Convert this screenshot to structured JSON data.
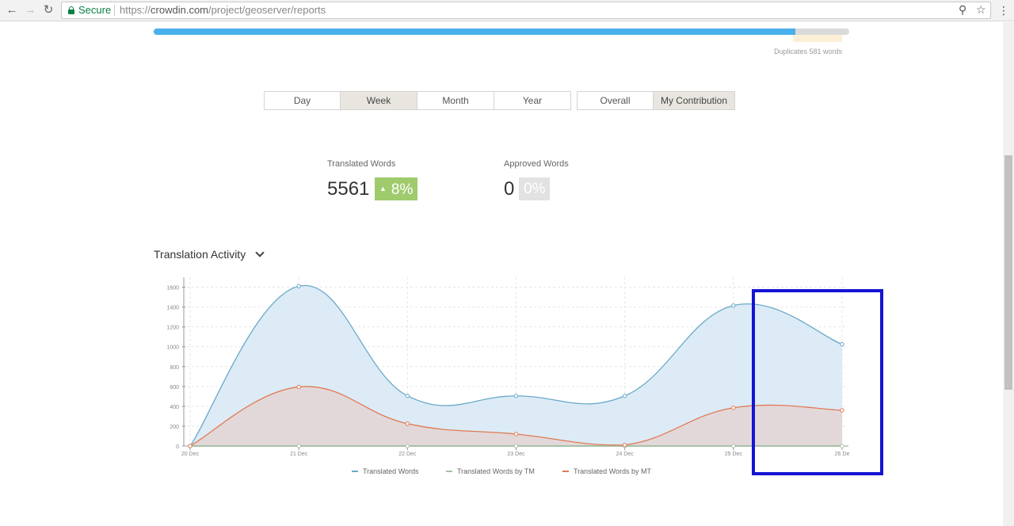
{
  "browser": {
    "back_icon": "back-arrow-icon",
    "forward_icon": "forward-arrow-icon",
    "reload_icon": "reload-icon",
    "secure_label": "Secure",
    "url_scheme": "https://",
    "url_host": "crowdin.com",
    "url_path": "/project/geoserver/reports"
  },
  "progress": {
    "translated_fraction": 0.922,
    "duplicates_text": "Duplicates 581 words",
    "colors": {
      "fill": "#48b0ea",
      "track": "#dadada",
      "duplicates": "#fbefd6"
    }
  },
  "period_tabs": [
    {
      "label": "Day",
      "active": false
    },
    {
      "label": "Week",
      "active": true
    },
    {
      "label": "Month",
      "active": false
    },
    {
      "label": "Year",
      "active": false
    }
  ],
  "scope_tabs": [
    {
      "label": "Overall",
      "active": false
    },
    {
      "label": "My Contribution",
      "active": true
    }
  ],
  "stats": {
    "translated": {
      "label": "Translated Words",
      "value": "5561",
      "badge_arrow": "▲",
      "badge": "8%"
    },
    "approved": {
      "label": "Approved Words",
      "value": "0",
      "badge": "0%"
    }
  },
  "section": {
    "title": "Translation Activity"
  },
  "chart_data": {
    "type": "area",
    "title": "",
    "xlabel": "",
    "ylabel": "",
    "categories": [
      "20 Dec",
      "21 Dec",
      "22 Dec",
      "23 Dec",
      "24 Dec",
      "25 Dec",
      "26 De"
    ],
    "ylim": [
      0,
      1700
    ],
    "yticks": [
      0,
      200,
      400,
      600,
      800,
      1000,
      1200,
      1400,
      1600
    ],
    "grid": true,
    "legend_position": "bottom",
    "series": [
      {
        "name": "Translated Words",
        "color": "#6aa9c8",
        "fill": "#d6e8f5",
        "values": [
          0,
          1610,
          505,
          505,
          505,
          1415,
          1025
        ]
      },
      {
        "name": "Translated Words by TM",
        "color": "#a7c0a5",
        "fill": "none",
        "values": [
          0,
          0,
          0,
          0,
          0,
          0,
          0
        ]
      },
      {
        "name": "Translated Words by MT",
        "color": "#e07b55",
        "fill": "#e4d5d4",
        "values": [
          0,
          595,
          225,
          120,
          10,
          385,
          360
        ]
      }
    ]
  }
}
